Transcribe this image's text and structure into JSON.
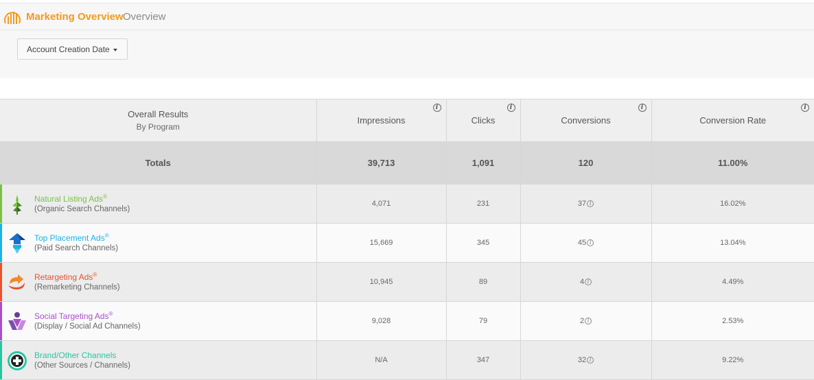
{
  "header": {
    "app_title": "Marketing Overview",
    "page_subtitle": "Overview",
    "logo_icon": "bar-chart-logo-icon",
    "brand_color": "#f39a1e"
  },
  "filter": {
    "dropdown_label": "Account Creation Date"
  },
  "table": {
    "columns": [
      {
        "label": "Overall Results",
        "sublabel": "By Program"
      },
      {
        "label": "Impressions"
      },
      {
        "label": "Clicks"
      },
      {
        "label": "Conversions"
      },
      {
        "label": "Conversion Rate"
      }
    ],
    "totals": {
      "label": "Totals",
      "impressions": "39,713",
      "clicks": "1,091",
      "conversions": "120",
      "conversion_rate": "11.00%"
    },
    "rows": [
      {
        "name": "Natural Listing Ads",
        "mark": "®",
        "description": "(Organic Search Channels)",
        "color": "#7bc142",
        "icon": "leaf-icon",
        "impressions": "4,071",
        "clicks": "231",
        "conversions": "37",
        "conversion_rate": "16.02%"
      },
      {
        "name": "Top Placement Ads",
        "mark": "®",
        "description": "(Paid Search Channels)",
        "color": "#1ab3e6",
        "icon": "top-arrow-icon",
        "impressions": "15,669",
        "clicks": "345",
        "conversions": "45",
        "conversion_rate": "13.04%"
      },
      {
        "name": "Retargeting Ads",
        "mark": "®",
        "description": "(Remarketing Channels)",
        "color": "#e8532d",
        "icon": "retarget-arrow-icon",
        "impressions": "10,945",
        "clicks": "89",
        "conversions": "4",
        "conversion_rate": "4.49%"
      },
      {
        "name": "Social Targeting Ads",
        "mark": "®",
        "description": "(Display / Social Ad Channels)",
        "color": "#a94fc8",
        "icon": "social-people-icon",
        "impressions": "9,028",
        "clicks": "79",
        "conversions": "2",
        "conversion_rate": "2.53%"
      },
      {
        "name": "Brand/Other Channels",
        "mark": "",
        "description": "(Other Sources / Channels)",
        "color": "#28c6a0",
        "icon": "plus-circle-icon",
        "impressions": "N/A",
        "clicks": "347",
        "conversions": "32",
        "conversion_rate": "9.22%"
      }
    ]
  }
}
